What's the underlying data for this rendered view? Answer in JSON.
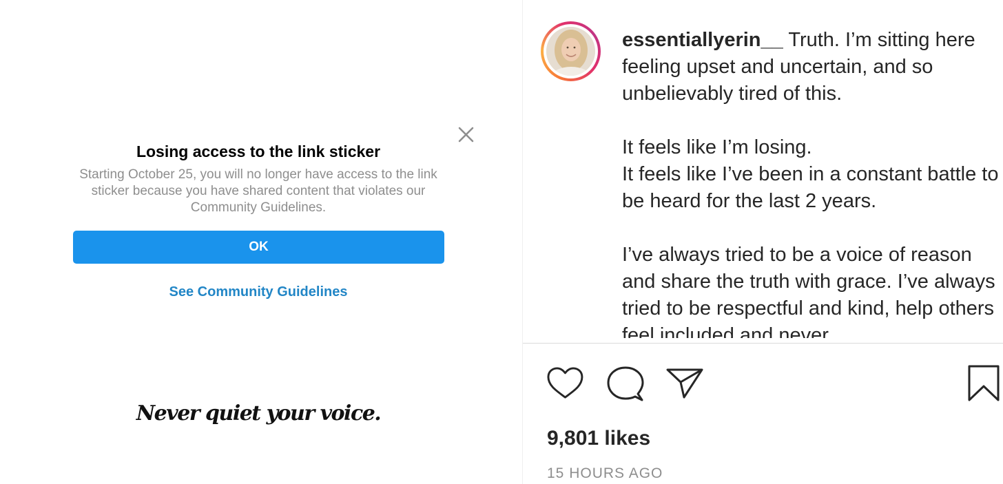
{
  "post_image": {
    "dialog": {
      "title": "Losing access to the link sticker",
      "body": "Starting October 25, you will no longer have access to the link sticker because you have shared content that violates our Community Guidelines.",
      "ok_label": "OK",
      "guidelines_link": "See Community Guidelines",
      "close_icon": "close-icon",
      "button_color": "#1a93ec",
      "link_color": "#2286c6"
    },
    "tagline": "Never quiet your voice."
  },
  "caption": {
    "username": "essentiallyerin__",
    "paragraphs": [
      "Truth. I’m sitting here feeling upset and uncertain, and so unbelievably tired of this.",
      "It feels like I’m losing.",
      "It feels like I’ve been in a constant battle to be heard for the last 2 years.",
      "I’ve always tried to be a voice of reason and share the truth with grace. I’ve always tried to be respectful and kind, help others feel included and never"
    ]
  },
  "actions": {
    "like_icon": "heart-icon",
    "comment_icon": "comment-bubble-icon",
    "share_icon": "paper-plane-icon",
    "save_icon": "bookmark-icon"
  },
  "likes": "9,801 likes",
  "timestamp": "15 HOURS AGO"
}
